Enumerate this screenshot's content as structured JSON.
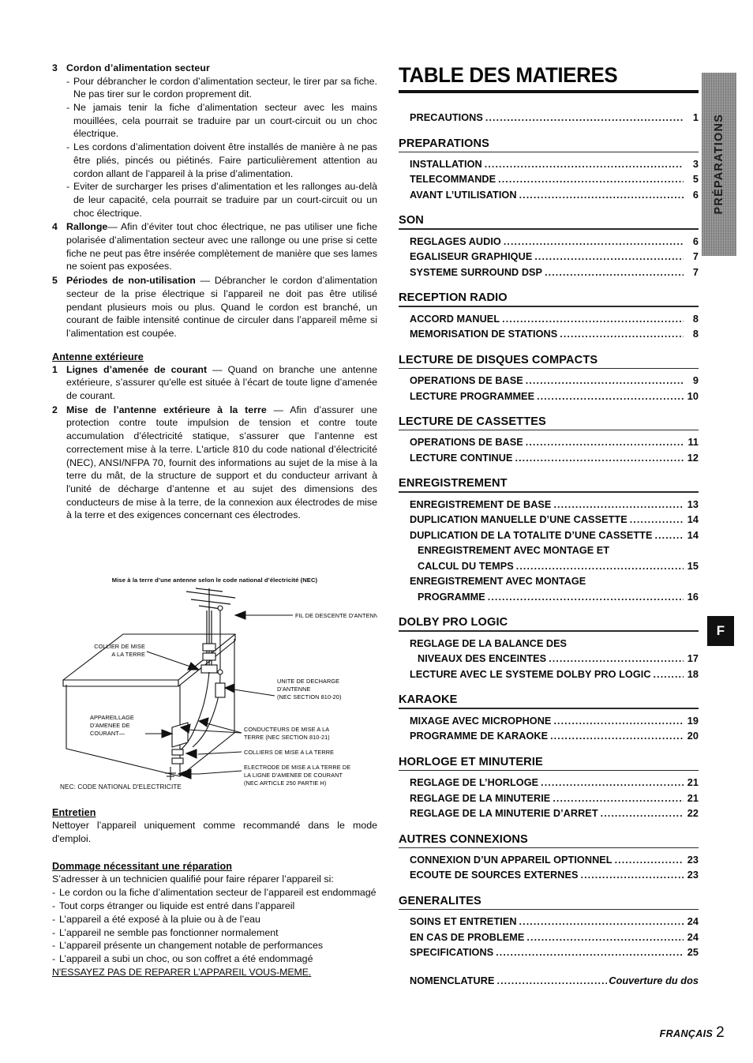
{
  "footer": {
    "language": "FRANÇAIS",
    "page_number": "2"
  },
  "side_tabs": {
    "section_tab": "PRÉPARATIONS",
    "language_tab": "F"
  },
  "left_column": {
    "items": [
      {
        "number": "3",
        "title": "Cordon d’alimentation secteur",
        "bullets": [
          "Pour débrancher le cordon d’alimentation secteur, le tirer par sa fiche. Ne pas tirer sur le cordon proprement dit.",
          "Ne jamais tenir la fiche d’alimentation secteur avec les mains mouillées, cela pourrait se traduire par un court-circuit ou un choc électrique.",
          "Les cordons d’alimentation doivent être installés de manière à ne pas être pliés, pincés ou piétinés. Faire particulièrement attention au cordon allant de l’appareil à la prise d’alimentation.",
          "Eviter de surcharger les prises d’alimentation et les rallonges au-delà de leur capacité, cela pourrait se traduire par un court-circuit ou un choc électrique."
        ]
      },
      {
        "number": "4",
        "title": "Rallonge",
        "dash": "—",
        "body": "Afin d’éviter tout choc électrique, ne pas utiliser une fiche polarisée d’alimentation secteur avec une rallonge ou une prise si cette fiche ne peut pas être insérée complètement de manière que ses lames ne soient pas exposées."
      },
      {
        "number": "5",
        "title": "Périodes de non-utilisation",
        "dash": "—",
        "body": "Débrancher le cordon d’alimentation secteur de la prise électrique si l’appareil ne doit pas être utilisé pendant plusieurs mois ou plus. Quand le cordon est branché, un courant de faible intensité continue de circuler dans l’appareil même si l’alimentation est coupée."
      }
    ],
    "antenna_section": {
      "heading": "Antenne extérieure",
      "items": [
        {
          "number": "1",
          "title": "Lignes d’amenée de courant",
          "dash": "—",
          "body": "Quand on branche une antenne extérieure, s’assurer qu'elle est située à l’écart de toute ligne d’amenée de courant."
        },
        {
          "number": "2",
          "title": "Mise de l’antenne extérieure à la terre",
          "dash": "—",
          "body": "Afin d’assurer une protection contre toute impulsion de tension et contre toute accumulation d’électricité statique, s’assurer que l’antenne est correctement mise à la terre. L'article 810 du code national d’électricité (NEC), ANSI/NFPA 70, fournit des informations au sujet de la mise à la terre du mât, de la structure de support et du conducteur arrivant à l'unité de décharge d’antenne et au sujet des dimensions des conducteurs de mise à la terre, de la connexion aux électrodes de mise à la terre et des exigences concernant ces électrodes."
        }
      ]
    },
    "entretien": {
      "heading": "Entretien",
      "body": "Nettoyer l’appareil uniquement comme recommandé dans le mode d'emploi."
    },
    "dommage": {
      "heading": "Dommage nécessitant une réparation",
      "intro": "S’adresser à un technicien qualifié pour faire réparer l’appareil si:",
      "bullets": [
        "Le cordon ou la fiche d’alimentation secteur de l’appareil est endommagé",
        "Tout corps étranger ou liquide est entré dans l’appareil",
        "L’appareil a été exposé à la pluie ou à de l’eau",
        "L’appareil ne semble pas fonctionner normalement",
        "L’appareil présente un changement notable de performances",
        "L’appareil a subi un choc, ou son coffret a été endommagé"
      ],
      "warning": "N'ESSAYEZ PAS DE REPARER L’APPAREIL VOUS-MEME."
    }
  },
  "diagram": {
    "caption": "Mise à la terre d’une antenne selon le code national  d’électricité (NEC)",
    "legend": "NEC: CODE NATIONAL D'ELECTRICITE",
    "labels": {
      "lead_in_wire": "FIL DE DESCENTE D'ANTENNE",
      "ground_clamp_roof": "COLLIER DE MISE\nA LA TERRE",
      "ground_clamp_roof_l1": "COLLIER DE MISE",
      "ground_clamp_roof_l2": "A LA TERRE",
      "antenna_discharge_l1": "UNITE DE DECHARGE",
      "antenna_discharge_l2": "D'ANTENNE",
      "antenna_discharge_l3": "(NEC SECTION 810-20)",
      "electric_service_l1": "APPAREILLAGE",
      "electric_service_l2": "D'AMENEE DE",
      "electric_service_l3": "COURANT—",
      "ground_conductors_l1": "CONDUCTEURS DE MISE A LA",
      "ground_conductors_l2": "TERRE (NEC SECTION 810-21)",
      "ground_clamps": "COLLIERS DE MISE A LA TERRE",
      "power_electrode_l1": "ELECTRODE DE MISE A LA TERRE DE",
      "power_electrode_l2": "LA LIGNE D'AMENEE DE  COURANT",
      "power_electrode_l3": "(NEC ARTICLE 250 PARTIE H)"
    }
  },
  "toc": {
    "title": "TABLE DES MATIERES",
    "top_entry": {
      "label": "PRECAUTIONS",
      "page": "1"
    },
    "groups": [
      {
        "heading": "PREPARATIONS",
        "entries": [
          {
            "label": "INSTALLATION",
            "page": "3"
          },
          {
            "label": "TELECOMMANDE",
            "page": "5"
          },
          {
            "label": "AVANT L’UTILISATION",
            "page": "6"
          }
        ]
      },
      {
        "heading": "SON",
        "entries": [
          {
            "label": "REGLAGES AUDIO",
            "page": "6"
          },
          {
            "label": "EGALISEUR GRAPHIQUE",
            "page": "7"
          },
          {
            "label": "SYSTEME SURROUND DSP",
            "page": "7"
          }
        ]
      },
      {
        "heading": "RECEPTION RADIO",
        "entries": [
          {
            "label": "ACCORD MANUEL",
            "page": "8"
          },
          {
            "label": "MEMORISATION DE STATIONS",
            "page": "8"
          }
        ]
      },
      {
        "heading": "LECTURE DE DISQUES COMPACTS",
        "entries": [
          {
            "label": "OPERATIONS DE BASE",
            "page": "9"
          },
          {
            "label": "LECTURE PROGRAMMEE",
            "page": "10"
          }
        ]
      },
      {
        "heading": "LECTURE DE CASSETTES",
        "entries": [
          {
            "label": "OPERATIONS DE BASE",
            "page": "11"
          },
          {
            "label": "LECTURE CONTINUE",
            "page": "12"
          }
        ]
      },
      {
        "heading": "ENREGISTREMENT",
        "entries": [
          {
            "label": "ENREGISTREMENT DE BASE",
            "page": "13"
          },
          {
            "label": "DUPLICATION MANUELLE D’UNE CASSETTE",
            "page": "14"
          },
          {
            "label": "DUPLICATION DE LA TOTALITE D’UNE CASSETTE",
            "page": "14"
          },
          {
            "label": "ENREGISTREMENT AVEC MONTAGE ET",
            "continuation": true,
            "indent": true
          },
          {
            "label": "CALCUL DU TEMPS",
            "page": "15",
            "indent": true
          },
          {
            "label": "ENREGISTREMENT AVEC MONTAGE",
            "continuation": true
          },
          {
            "label": "PROGRAMME",
            "page": "16",
            "indent": true
          }
        ]
      },
      {
        "heading": "DOLBY PRO LOGIC",
        "entries": [
          {
            "label": "REGLAGE DE LA BALANCE DES",
            "continuation": true
          },
          {
            "label": "NIVEAUX DES ENCEINTES",
            "page": "17",
            "indent": true
          },
          {
            "label": "LECTURE AVEC LE SYSTEME DOLBY PRO LOGIC",
            "page": "18"
          }
        ]
      },
      {
        "heading": "KARAOKE",
        "entries": [
          {
            "label": "MIXAGE AVEC MICROPHONE",
            "page": "19"
          },
          {
            "label": "PROGRAMME DE KARAOKE",
            "page": "20"
          }
        ]
      },
      {
        "heading": "HORLOGE ET MINUTERIE",
        "entries": [
          {
            "label": "REGLAGE DE L’HORLOGE",
            "page": "21"
          },
          {
            "label": "REGLAGE DE LA MINUTERIE",
            "page": "21"
          },
          {
            "label": "REGLAGE DE LA MINUTERIE D’ARRET",
            "page": "22"
          }
        ]
      },
      {
        "heading": "AUTRES CONNEXIONS",
        "entries": [
          {
            "label": "CONNEXION D’UN APPAREIL OPTIONNEL",
            "page": "23"
          },
          {
            "label": "ECOUTE DE SOURCES EXTERNES",
            "page": "23"
          }
        ]
      },
      {
        "heading": "GENERALITES",
        "entries": [
          {
            "label": "SOINS ET ENTRETIEN",
            "page": "24"
          },
          {
            "label": "EN CAS DE PROBLEME",
            "page": "24"
          },
          {
            "label": "SPECIFICATIONS",
            "page": "25"
          }
        ]
      }
    ],
    "final_entry": {
      "label": "NOMENCLATURE",
      "page": "Couverture du dos"
    }
  }
}
